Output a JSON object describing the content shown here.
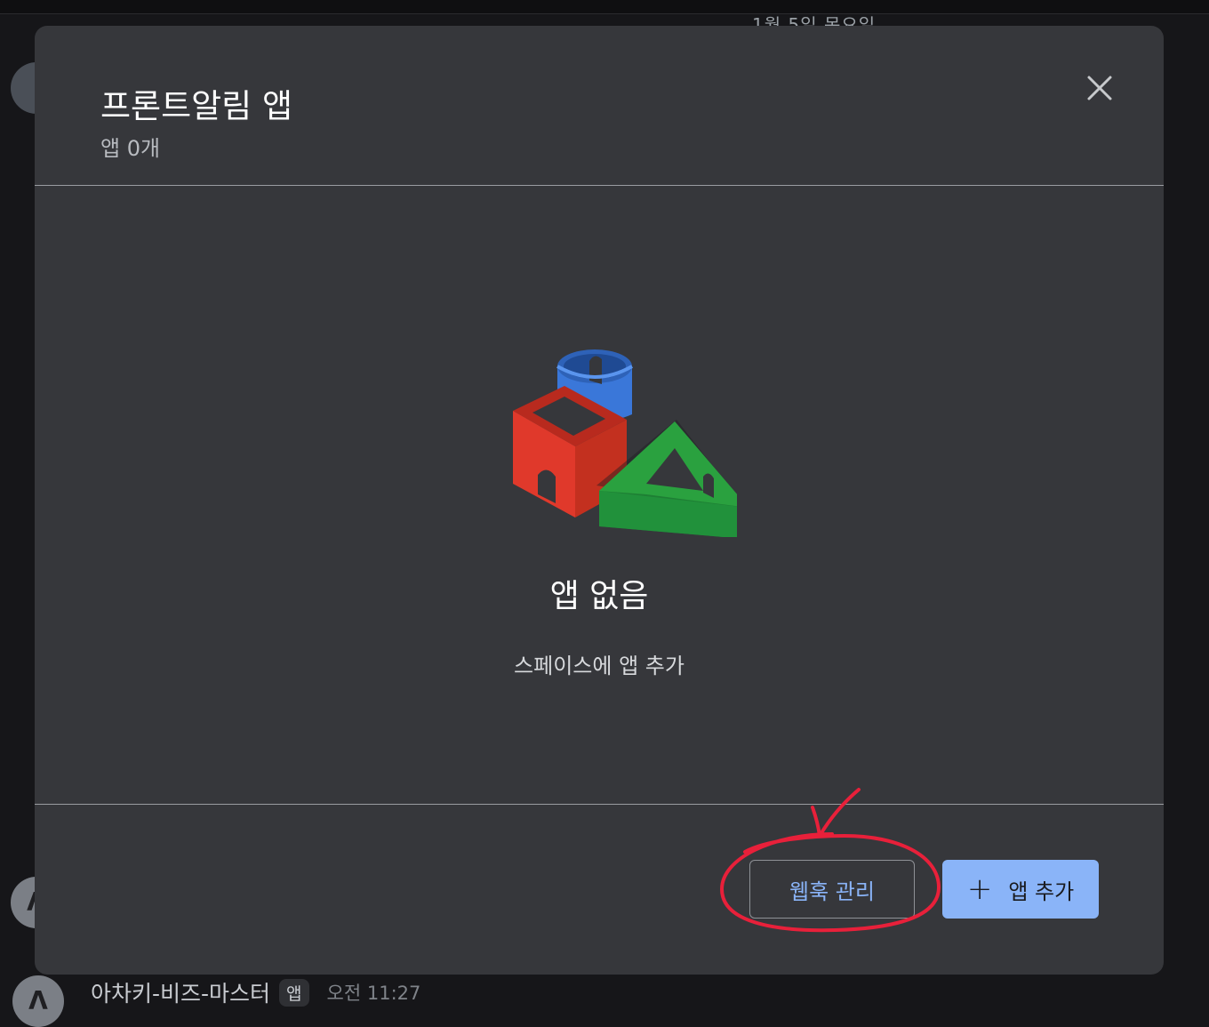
{
  "background": {
    "date_label": "1월 5일 목요일",
    "message": {
      "sender": "아차키-비즈-마스터",
      "badge": "앱",
      "time": "오전 11:27"
    }
  },
  "dialog": {
    "title": "프론트알림 앱",
    "subtitle": "앱 0개",
    "close_icon": "close-icon",
    "empty_state": {
      "title": "앱 없음",
      "subtitle": "스페이스에 앱 추가"
    },
    "buttons": {
      "manage_webhooks": "웹훅 관리",
      "add_app": "앱 추가",
      "add_icon": "plus-icon"
    }
  },
  "colors": {
    "dialog_bg": "#36373b",
    "accent": "#8ab4f8",
    "annotation": "#e8203a"
  }
}
